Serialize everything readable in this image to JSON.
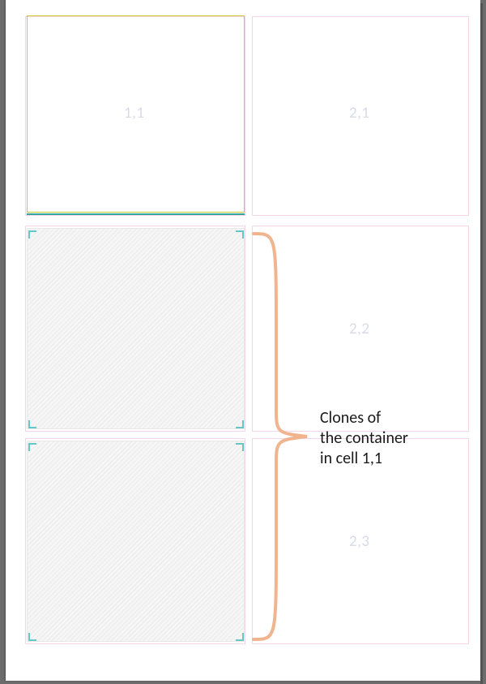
{
  "cells": {
    "c11": "1,1",
    "c21": "2,1",
    "c22": "2,2",
    "c23": "2,3"
  },
  "annotation": {
    "line1": "Clones of",
    "line2": "the container",
    "line3": "in cell 1,1"
  },
  "colors": {
    "cell_border": "#ecd0e1",
    "select_border": "#c9cc2c",
    "divider": "#2fa79a",
    "crop": "#67c7c7",
    "brace": "#f0b48e"
  }
}
